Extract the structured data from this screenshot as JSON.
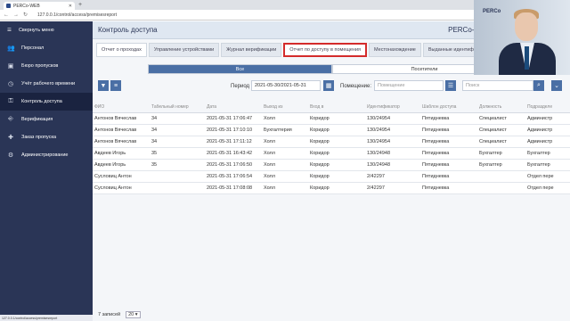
{
  "browser": {
    "tab_title": "PERCo-WEB",
    "url": "127.0.0.1/control/access/premisesreport",
    "status_url": "127.0.0.1/control/access/premisesreport"
  },
  "sidebar": {
    "collapse_label": "Свернуть меню",
    "items": [
      {
        "label": "Персонал",
        "icon": "people-icon"
      },
      {
        "label": "Бюро пропусков",
        "icon": "id-card-icon"
      },
      {
        "label": "Учёт рабочего времени",
        "icon": "clock-icon"
      },
      {
        "label": "Контроль доступа",
        "icon": "key-icon",
        "active": true
      },
      {
        "label": "Верификация",
        "icon": "verify-icon"
      },
      {
        "label": "Заказ пропуска",
        "icon": "pass-order-icon"
      },
      {
        "label": "Администрирование",
        "icon": "gear-icon"
      }
    ]
  },
  "header": {
    "title": "Контроль доступа",
    "brand": "PERCo-W"
  },
  "tabs": [
    {
      "label": "Отчет о проходах",
      "state": "active"
    },
    {
      "label": "Управление устройствами",
      "state": "normal"
    },
    {
      "label": "Журнал верификации",
      "state": "normal"
    },
    {
      "label": "Отчет по доступу в помещения",
      "state": "highlighted"
    },
    {
      "label": "Местонахождение",
      "state": "normal"
    },
    {
      "label": "Выданные идентиф",
      "state": "normal"
    }
  ],
  "filter": {
    "all_label": "Все",
    "visitors_label": "Посетители"
  },
  "toolbar": {
    "period_label": "Период",
    "period_value": "2021-05-30/2021-05-31",
    "premises_label": "Помещение:",
    "premises_placeholder": "Помещение",
    "search_placeholder": "Поиск"
  },
  "table": {
    "columns": [
      "ФИО",
      "Табельный номер",
      "Дата",
      "Выход из",
      "Вход в",
      "Идентификатор",
      "Шаблон доступа",
      "Должность",
      "Подразделе"
    ],
    "rows": [
      [
        "Антонов Вячеслав",
        "34",
        "2021-05-31 17:06:47",
        "Холл",
        "Коридор",
        "130/24954",
        "Пятидневка",
        "Специалист",
        "Администр"
      ],
      [
        "Антонов Вячеслав",
        "34",
        "2021-05-31 17:10:10",
        "Бухгалтерия",
        "Коридор",
        "130/24954",
        "Пятидневка",
        "Специалист",
        "Администр"
      ],
      [
        "Антонов Вячеслав",
        "34",
        "2021-05-31 17:11:12",
        "Холл",
        "Коридор",
        "130/24954",
        "Пятидневка",
        "Специалист",
        "Администр"
      ],
      [
        "Авдеев Игорь",
        "35",
        "2021-05-31 16:43:42",
        "Холл",
        "Коридор",
        "130/24948",
        "Пятидневка",
        "Бухгалтер",
        "Бухгалтер"
      ],
      [
        "Авдеев Игорь",
        "35",
        "2021-05-31 17:06:50",
        "Холл",
        "Коридор",
        "130/24948",
        "Пятидневка",
        "Бухгалтер",
        "Бухгалтер"
      ],
      [
        "Сусловиц Антон",
        "",
        "2021-05-31 17:06:54",
        "Холл",
        "Коридор",
        "2/42297",
        "Пятидневка",
        "",
        "Отдел пере"
      ],
      [
        "Сусловиц Антон",
        "",
        "2021-05-31 17:08:08",
        "Холл",
        "Коридор",
        "2/42297",
        "Пятидневка",
        "",
        "Отдел пере"
      ]
    ]
  },
  "footer": {
    "records_label": "7 записей",
    "page_size": "20"
  },
  "video": {
    "logo": "PERCo"
  }
}
